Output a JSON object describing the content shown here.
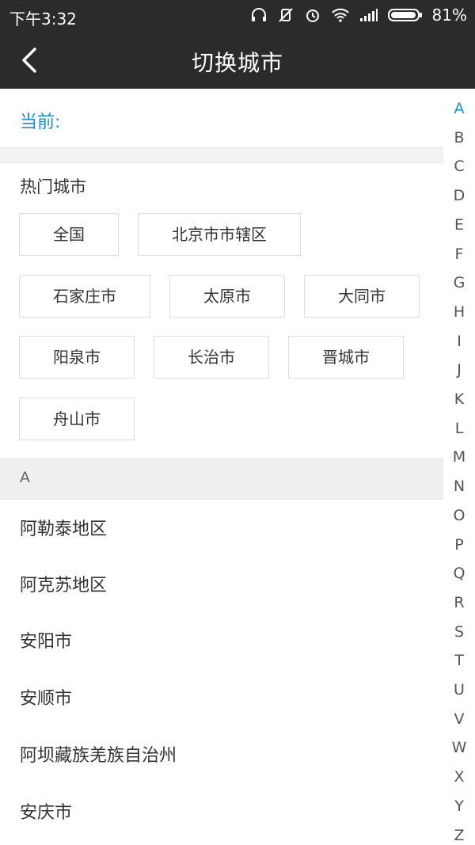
{
  "status_bar": {
    "time": "下午3:32",
    "battery": "81%",
    "icons": [
      "headphones-icon",
      "vibrate-off-icon",
      "alarm-icon",
      "wifi-icon",
      "signal-icon",
      "battery-icon"
    ]
  },
  "header": {
    "title": "切换城市",
    "back_icon": "back-arrow-icon"
  },
  "current": {
    "label": "当前:"
  },
  "hot": {
    "title": "热门城市",
    "cities": [
      "全国",
      "北京市市辖区",
      "石家庄市",
      "太原市",
      "大同市",
      "阳泉市",
      "长治市",
      "晋城市",
      "舟山市"
    ]
  },
  "section": {
    "letter": "A",
    "cities": [
      "阿勒泰地区",
      "阿克苏地区",
      "安阳市",
      "安顺市",
      "阿坝藏族羌族自治州",
      "安庆市"
    ]
  },
  "index": {
    "letters": [
      "A",
      "B",
      "C",
      "D",
      "E",
      "F",
      "G",
      "H",
      "I",
      "J",
      "K",
      "L",
      "M",
      "N",
      "O",
      "P",
      "Q",
      "R",
      "S",
      "T",
      "U",
      "V",
      "W",
      "X",
      "Y",
      "Z"
    ],
    "active": "A",
    "active_color": "#1e8fd3"
  },
  "colors": {
    "bar": "#2b2b2b",
    "accent": "#1e8fd3"
  }
}
